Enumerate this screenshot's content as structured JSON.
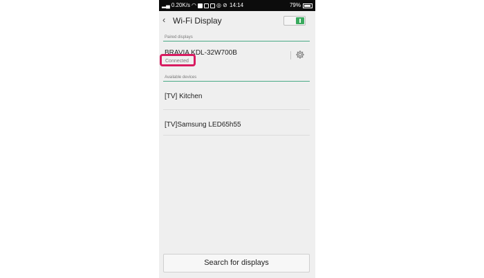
{
  "status_bar": {
    "network_speed": "0.20K/s",
    "time": "14:14",
    "battery": "79%"
  },
  "header": {
    "back_icon": "chevron-left-icon",
    "title": "Wi-Fi Display",
    "toggle_on": true,
    "accent_color": "#3aaa5e"
  },
  "paired_section": {
    "label": "Paired displays",
    "devices": [
      {
        "name": "BRAVIA KDL-32W700B",
        "status": "Connected",
        "settings_icon": "gear-icon"
      }
    ]
  },
  "available_section": {
    "label": "Available devices",
    "devices": [
      {
        "name": "[TV] Kitchen"
      },
      {
        "name": "[TV]Samsung LED65h55"
      }
    ]
  },
  "footer": {
    "search_label": "Search for displays"
  },
  "highlight_color": "#d81b60"
}
